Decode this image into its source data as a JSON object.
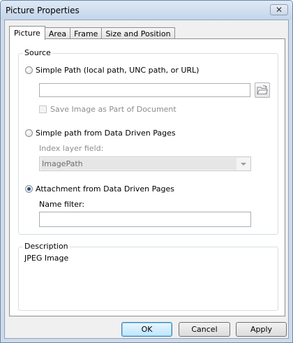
{
  "window": {
    "title": "Picture Properties",
    "close_glyph": "✕"
  },
  "tabs": [
    {
      "label": "Picture",
      "active": true
    },
    {
      "label": "Area",
      "active": false
    },
    {
      "label": "Frame",
      "active": false
    },
    {
      "label": "Size and Position",
      "active": false
    }
  ],
  "source": {
    "legend": "Source",
    "simple_path": {
      "label": "Simple Path (local path, UNC path, or URL)",
      "checked": false,
      "value": "",
      "save_image_label": "Save Image as Part of Document",
      "save_image_checked": false
    },
    "ddp_path": {
      "label": "Simple path from Data Driven Pages",
      "checked": false,
      "index_field_label": "Index layer field:",
      "index_field_value": "ImagePath"
    },
    "attachment": {
      "label": "Attachment from Data Driven Pages",
      "checked": true,
      "name_filter_label": "Name filter:",
      "name_filter_value": ""
    }
  },
  "description": {
    "legend": "Description",
    "text": "JPEG Image"
  },
  "buttons": {
    "ok": "OK",
    "cancel": "Cancel",
    "apply": "Apply"
  },
  "icons": {
    "browse": "folder-open-icon"
  }
}
